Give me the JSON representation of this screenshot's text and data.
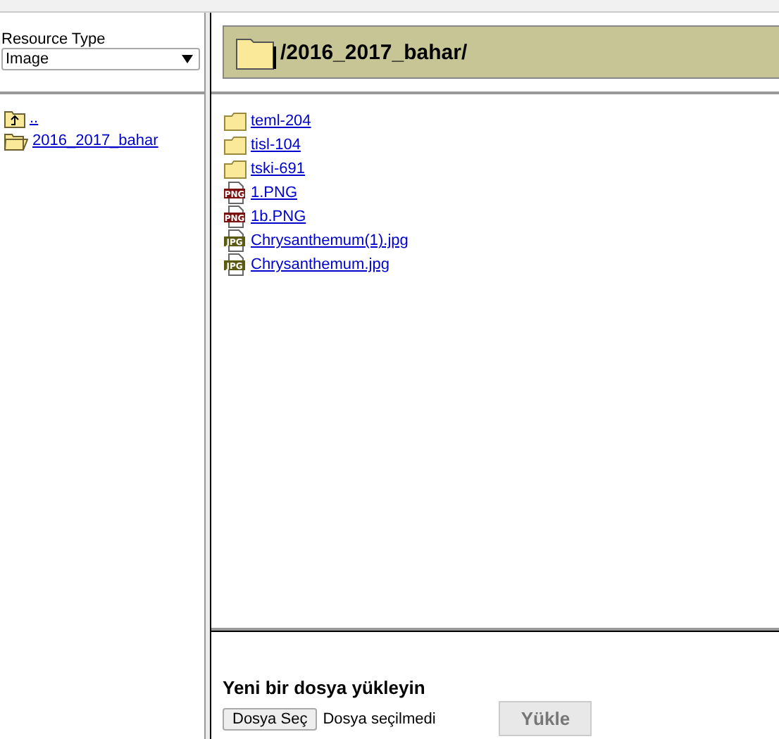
{
  "resource_type": {
    "label": "Resource Type",
    "value": "Image"
  },
  "tree": [
    {
      "kind": "up",
      "label": ".."
    },
    {
      "kind": "folder",
      "label": "2016_2017_bahar"
    }
  ],
  "current_path": "/2016_2017_bahar/",
  "items": [
    {
      "kind": "folder",
      "name": "teml-204"
    },
    {
      "kind": "folder",
      "name": "tisl-104"
    },
    {
      "kind": "folder",
      "name": "tski-691"
    },
    {
      "kind": "file",
      "type": "PNG",
      "name": "1.PNG"
    },
    {
      "kind": "file",
      "type": "PNG",
      "name": "1b.PNG"
    },
    {
      "kind": "file",
      "type": "JPG",
      "name": "Chrysanthemum(1).jpg"
    },
    {
      "kind": "file",
      "type": "JPG",
      "name": "Chrysanthemum.jpg"
    }
  ],
  "upload": {
    "title": "Yeni bir dosya yükleyin",
    "choose_button": "Dosya Seç",
    "file_status": "Dosya seçilmedi",
    "upload_button": {
      "label": "Yükle",
      "disabled": true
    }
  }
}
